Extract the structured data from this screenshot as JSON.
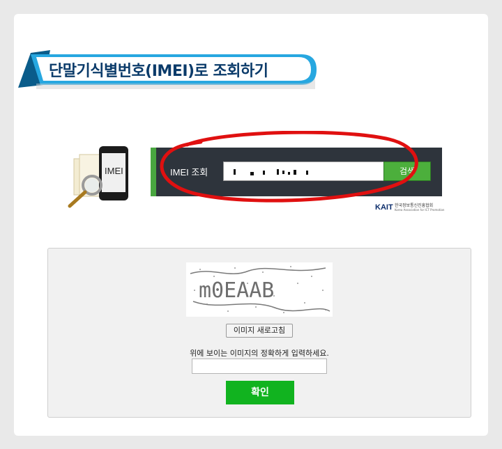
{
  "title": "단말기식별번호(IMEI)로 조회하기",
  "illustration": {
    "phone_label": "IMEI",
    "icon": "phone-magnifier-icon"
  },
  "search": {
    "label": "IMEI 조회",
    "button_label": "검색",
    "value_masked": true
  },
  "org_logo": {
    "mark": "KAIT",
    "name": "한국정보통신진흥협회",
    "subtitle": "Korea Association for ICT Promotion"
  },
  "captcha": {
    "image_text": "m0EAAB",
    "refresh_button": "이미지 새로고침",
    "instruction": "위에 보이는 이미지의 정확하게 입력하세요.",
    "input_value": "",
    "confirm_button": "확인"
  },
  "colors": {
    "accent_green": "#11b31f",
    "banner_blue": "#1ea0dc",
    "search_panel": "#2e343c",
    "annotation_red": "#e01010"
  }
}
